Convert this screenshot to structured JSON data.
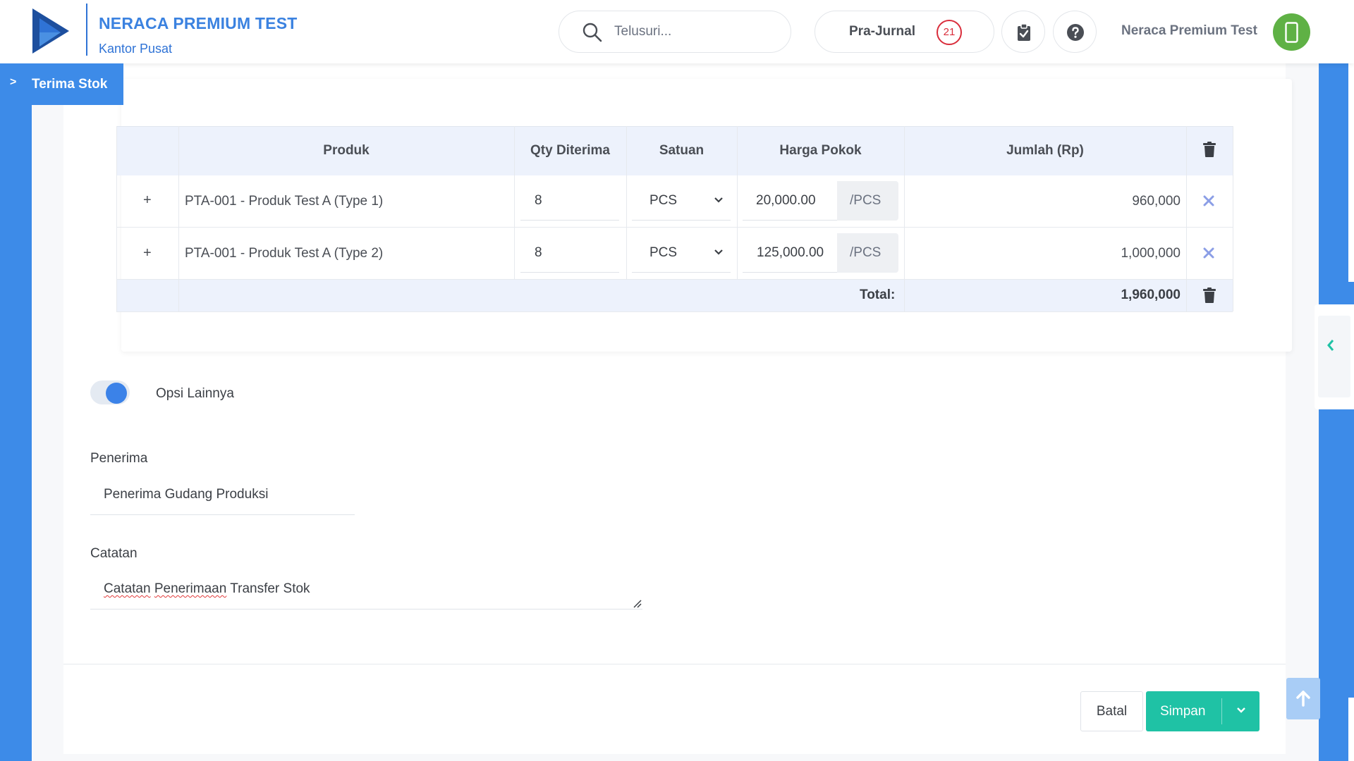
{
  "header": {
    "company_name": "NERACA PREMIUM TEST",
    "branch": "Kantor Pusat",
    "search_placeholder": "Telusuri...",
    "prajurnal_label": "Pra-Jurnal",
    "prajurnal_count": "21",
    "user_name": "Neraca Premium Test"
  },
  "page": {
    "title": "Terima Stok"
  },
  "table": {
    "headers": [
      "Produk",
      "Qty Diterima",
      "Satuan",
      "Harga Pokok",
      "Jumlah (Rp)"
    ],
    "rows": [
      {
        "expand": "+",
        "produk": "PTA-001 - Produk Test A (Type 1)",
        "qty": "8",
        "satuan": "PCS",
        "harga": "20,000.00",
        "per_unit": "/PCS",
        "jumlah": "960,000"
      },
      {
        "expand": "+",
        "produk": "PTA-001 - Produk Test A (Type 2)",
        "qty": "8",
        "satuan": "PCS",
        "harga": "125,000.00",
        "per_unit": "/PCS",
        "jumlah": "1,000,000"
      }
    ],
    "total_label": "Total:",
    "total_value": "1,960,000"
  },
  "options": {
    "toggle_label": "Opsi Lainnya",
    "toggle_on": true,
    "penerima_label": "Penerima",
    "penerima_value": "Penerima Gudang Produksi",
    "catatan_label": "Catatan",
    "catatan_word1": "Catatan",
    "catatan_word2": "Penerimaan",
    "catatan_rest": "Transfer Stok"
  },
  "footer": {
    "cancel_label": "Batal",
    "save_label": "Simpan"
  },
  "colors": {
    "primary": "#3d8be8",
    "accent": "#1fc2a5",
    "badge": "#d92d3b",
    "avatar": "#5fb145"
  }
}
